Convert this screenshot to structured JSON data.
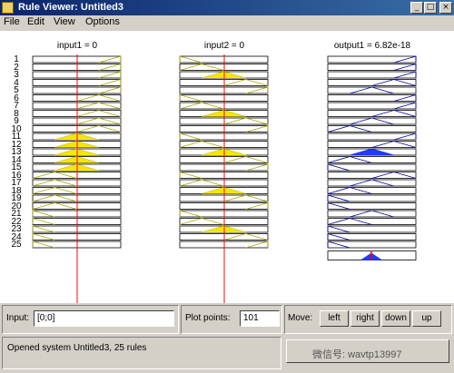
{
  "window": {
    "title": "Rule Viewer: Untitled3",
    "min_glyph": "_",
    "max_glyph": "□",
    "close_glyph": "×"
  },
  "menu": [
    "File",
    "Edit",
    "View",
    "Options"
  ],
  "columns": [
    {
      "header": "input1 = 0"
    },
    {
      "header": "input2 = 0"
    },
    {
      "header": "output1 = 6.82e-18"
    }
  ],
  "rules": [
    "1",
    "2",
    "3",
    "4",
    "5",
    "6",
    "7",
    "8",
    "9",
    "10",
    "11",
    "12",
    "13",
    "14",
    "15",
    "16",
    "17",
    "18",
    "19",
    "20",
    "21",
    "22",
    "23",
    "24",
    "25"
  ],
  "input1_mf": [
    4,
    4,
    4,
    4,
    4,
    3,
    3,
    3,
    3,
    3,
    2,
    2,
    2,
    2,
    2,
    1,
    1,
    1,
    1,
    1,
    0,
    0,
    0,
    0,
    0
  ],
  "input2_mf": [
    0,
    1,
    2,
    3,
    4,
    0,
    1,
    2,
    3,
    4,
    0,
    1,
    2,
    3,
    4,
    0,
    1,
    2,
    3,
    4,
    0,
    1,
    2,
    3,
    4
  ],
  "output_mf": [
    4,
    4,
    4,
    3,
    2,
    4,
    4,
    3,
    2,
    1,
    4,
    3,
    2,
    1,
    0,
    3,
    2,
    1,
    0,
    0,
    2,
    1,
    0,
    0,
    0
  ],
  "bottom": {
    "input_label": "Input:",
    "input_value": "[0;0]",
    "plot_points_label": "Plot points:",
    "plot_points_value": "101",
    "move_label": "Move:",
    "buttons": {
      "left": "left",
      "right": "right",
      "down": "down",
      "up": "up"
    },
    "status": "Opened system Untitled3, 25 rules",
    "watermark": "微信号: wavtp13997"
  },
  "colors": {
    "fill_input": "#f5e600",
    "fill_output": "#1f3cff",
    "mf_input": "#a8a800",
    "mf_output": "#0000a0",
    "indicator_line": "#ff0000"
  }
}
